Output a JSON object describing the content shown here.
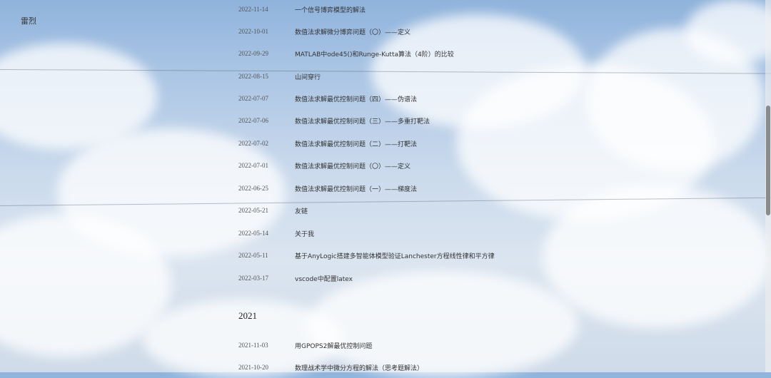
{
  "site": {
    "name": "雷烈"
  },
  "posts_2022": [
    {
      "date": "2022-11-14",
      "title": "一个信号博弈模型的解法"
    },
    {
      "date": "2022-10-01",
      "title": "数值法求解微分博弈问题（〇）——定义"
    },
    {
      "date": "2022-09-29",
      "title": "MATLAB中ode45()和Runge-Kutta算法（4阶）的比较"
    },
    {
      "date": "2022-08-15",
      "title": "山间穿行"
    },
    {
      "date": "2022-07-07",
      "title": "数值法求解最优控制问题（四）——伪谱法"
    },
    {
      "date": "2022-07-06",
      "title": "数值法求解最优控制问题（三）——多重打靶法"
    },
    {
      "date": "2022-07-02",
      "title": "数值法求解最优控制问题（二）——打靶法"
    },
    {
      "date": "2022-07-01",
      "title": "数值法求解最优控制问题（〇）——定义"
    },
    {
      "date": "2022-06-25",
      "title": "数值法求解最优控制问题（一）——梯度法"
    },
    {
      "date": "2022-05-21",
      "title": "友链"
    },
    {
      "date": "2022-05-14",
      "title": "关于我"
    },
    {
      "date": "2022-05-11",
      "title": "基于AnyLogic搭建多智能体模型验证Lanchester方程线性律和平方律"
    },
    {
      "date": "2022-03-17",
      "title": "vscode中配置latex"
    }
  ],
  "year_2021": {
    "label": "2021"
  },
  "posts_2021": [
    {
      "date": "2021-11-03",
      "title": "用GPOPS2解最优控制问题"
    },
    {
      "date": "2021-10-20",
      "title": "数理战术学中微分方程的解法（思考题解法）"
    }
  ]
}
